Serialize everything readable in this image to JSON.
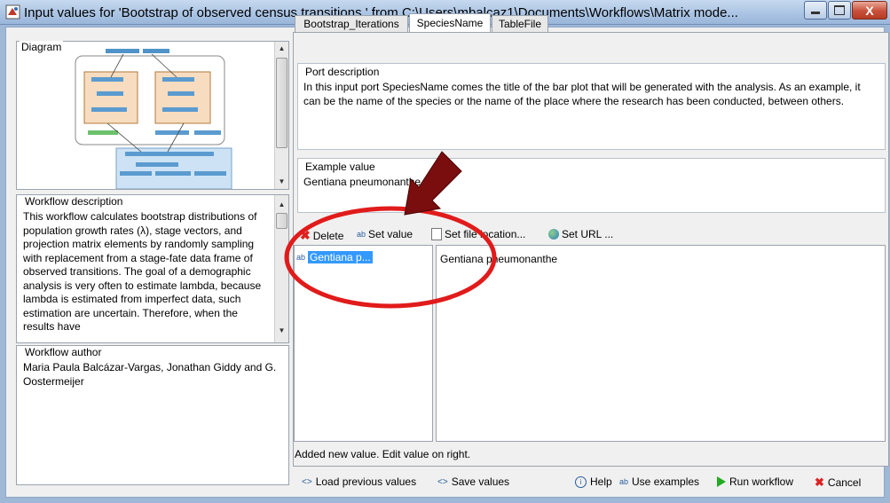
{
  "window": {
    "title": "Input values for 'Bootstrap of  observed census transitions.' from C:\\Users\\mbalcaz1\\Documents\\Workflows\\Matrix mode...",
    "close_label": "X"
  },
  "left": {
    "diagram_label": "Diagram",
    "workflow_description_label": "Workflow description",
    "workflow_description": "This workflow calculates bootstrap distributions of population growth rates (λ), stage vectors, and projection matrix elements by randomly sampling with replacement from a stage-fate data frame of observed transitions. The goal of a demographic analysis is very often to estimate lambda, because lambda is estimated from imperfect data, such estimation are uncertain. Therefore, when the results have",
    "workflow_author_label": "Workflow author",
    "workflow_author": "Maria Paula Balcázar-Vargas, Jonathan Giddy and G. Oostermeijer"
  },
  "tabs": [
    {
      "label": "Bootstrap_Iterations",
      "active": false
    },
    {
      "label": "SpeciesName",
      "active": true
    },
    {
      "label": "TableFile",
      "active": false
    }
  ],
  "port_description": {
    "label": "Port description",
    "text": "In this input port SpeciesName comes the title of the bar plot that will be generated with the analysis. As an example, it can be the name of the species or the name of the place where the research has been conducted, between others."
  },
  "example_value": {
    "label": "Example value",
    "text": "Gentiana pneumonanthe"
  },
  "toolbar": {
    "delete": "Delete",
    "set_value": "Set value",
    "set_file_location": "Set file location...",
    "set_url": "Set URL ..."
  },
  "values_list": {
    "items": [
      "Gentiana p..."
    ],
    "editor_value": "Gentiana pneumonanthe"
  },
  "status": "Added new value.  Edit value on right.",
  "bottom": {
    "load_previous": "Load previous values",
    "save_values": "Save values",
    "help": "Help",
    "use_examples": "Use examples",
    "run_workflow": "Run workflow",
    "cancel": "Cancel"
  },
  "colors": {
    "selection": "#3399ff",
    "annotation_red": "#e11b1b",
    "arrow_dark_red": "#7a0d0d",
    "run_green": "#22aa22"
  }
}
